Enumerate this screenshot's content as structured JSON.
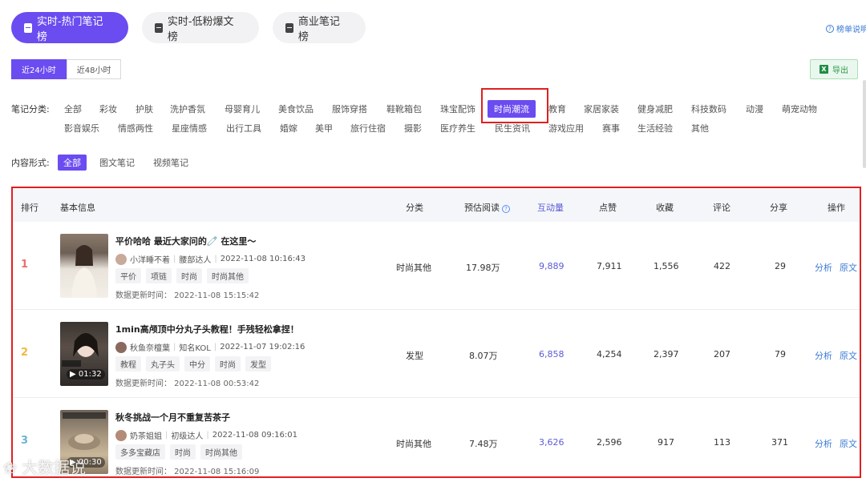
{
  "top_tabs": [
    {
      "label": "实时-热门笔记榜",
      "active": true
    },
    {
      "label": "实时-低粉爆文榜",
      "active": false
    },
    {
      "label": "商业笔记榜",
      "active": false
    }
  ],
  "help_link": "榜单说明",
  "time_range": [
    "近24小时",
    "近48小时"
  ],
  "export_label": "导出",
  "category_label": "笔记分类:",
  "categories_row1": [
    "全部",
    "彩妆",
    "护肤",
    "洗护香氛",
    "母婴育儿",
    "美食饮品",
    "服饰穿搭",
    "鞋靴箱包",
    "珠宝配饰",
    "时尚潮流",
    "教育",
    "家居家装",
    "健身减肥",
    "科技数码",
    "动漫",
    "萌宠动物"
  ],
  "categories_row2": [
    "影音娱乐",
    "情感两性",
    "星座情感",
    "出行工具",
    "婚嫁",
    "美甲",
    "旅行住宿",
    "摄影",
    "医疗养生",
    "民生资讯",
    "游戏应用",
    "赛事",
    "生活经验",
    "其他"
  ],
  "active_category": "时尚潮流",
  "form_label": "内容形式:",
  "form_options": [
    "全部",
    "图文笔记",
    "视频笔记"
  ],
  "table": {
    "headers": {
      "rank": "排行",
      "info": "基本信息",
      "category": "分类",
      "est_read": "预估阅读",
      "interaction": "互动量",
      "likes": "点赞",
      "favorites": "收藏",
      "comments": "评论",
      "shares": "分享",
      "actions": "操作"
    },
    "rows": [
      {
        "rank": "1",
        "rank_color": "#e8716f",
        "title": "平价哈哈 最近大家问的🧷 在这里～",
        "author": "小洋睡不着",
        "level": "腰部达人",
        "time": "2022-11-08 10:16:43",
        "tags": [
          "平价",
          "项链",
          "时尚",
          "时尚其他"
        ],
        "update": "数据更新时间：  2022-11-08 15:15:42",
        "category": "时尚其他",
        "est_read": "17.98万",
        "interaction": "9,889",
        "likes": "7,911",
        "favorites": "1,556",
        "comments": "422",
        "shares": "29",
        "duration": ""
      },
      {
        "rank": "2",
        "rank_color": "#f0b840",
        "title": "1min高颅顶中分丸子头教程！手残轻松拿捏！",
        "author": "秋鱼奈檀葉",
        "level": "知名KOL",
        "time": "2022-11-07 19:02:16",
        "tags": [
          "教程",
          "丸子头",
          "中分",
          "时尚",
          "发型"
        ],
        "update": "数据更新时间：  2022-11-08 00:53:42",
        "category": "发型",
        "est_read": "8.07万",
        "interaction": "6,858",
        "likes": "4,254",
        "favorites": "2,397",
        "comments": "207",
        "shares": "79",
        "duration": "01:32"
      },
      {
        "rank": "3",
        "rank_color": "#6fb3d2",
        "title": "秋冬挑战一个月不重复苦茶子",
        "author": "奶茶姐姐",
        "level": "初级达人",
        "time": "2022-11-08 09:16:01",
        "tags": [
          "多多宝藏店",
          "时尚",
          "时尚其他"
        ],
        "update": "数据更新时间：  2022-11-08 15:16:09",
        "category": "时尚其他",
        "est_read": "7.48万",
        "interaction": "3,626",
        "likes": "2,596",
        "favorites": "917",
        "comments": "113",
        "shares": "371",
        "duration": "00:30"
      }
    ],
    "action_analyze": "分析",
    "action_source": "原文"
  },
  "watermark": "大数据说"
}
